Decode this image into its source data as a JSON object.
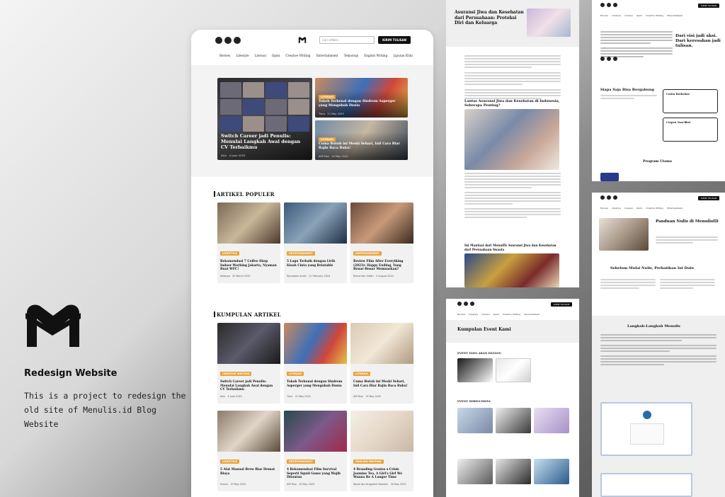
{
  "project": {
    "title": "Redesign Website",
    "description": "This is a project to redesign the old site of Menulis.id Blog Website",
    "logo_icon": "menulis-m-logo"
  },
  "colors": {
    "accent": "#e9a33b",
    "dark": "#111111"
  },
  "mockup": {
    "search_placeholder": "Cari artikel...",
    "cta_button": "KIRIM TULISAN",
    "nav": [
      "Review",
      "Lifestyle",
      "Literasi",
      "Opini",
      "Creative Writing",
      "Entertainment",
      "Teknologi",
      "English Writing",
      "Liputan Klini"
    ],
    "hero": {
      "main": {
        "title": "Switch Career jadi Penulis: Menulai Langkah Awal dengan CV Terbaikmu",
        "author": "Akiv",
        "date": "4 June 2025"
      },
      "side": [
        {
          "badge": "LITERASI",
          "title": "Tokoh Terkenal dengan Sindrom Asperger yang Mengubah Dunia",
          "author": "Tiara",
          "date": "21 May 2025"
        },
        {
          "badge": "LITERASI",
          "title": "Cuma Butuh ini Meski Sehari, Inil Cara Biar Rajin Baca Buku!",
          "author": "Afif Risa",
          "date": "19 May 2025"
        }
      ]
    },
    "popular": {
      "title": "ARTIKEL POPULER",
      "items": [
        {
          "badge": "LIFESTYLE",
          "title": "Rekomendasi 7 Coffee Shop Indoor Working Jakarta, Nyaman Buat WFC!",
          "author": "Natasya",
          "date": "22 March 2025"
        },
        {
          "badge": "ENTERTAINMENT",
          "title": "5 Lagu Terbaik dengan Lirik Kisah Cinta yang Relatable",
          "author": "Ramadani Andin",
          "date": "21 February 2024"
        },
        {
          "badge": "ENTERTAINMENT",
          "title": "Review Film After Everything (2023): Happy Ending, Yang Benar-Benar Memuaskan?",
          "author": "Risma Nur Safitri",
          "date": "5 August 2024"
        }
      ]
    },
    "collection": {
      "title": "KUMPULAN ARTIKEL",
      "items": [
        {
          "badge": "CREATIVE WRITING",
          "title": "Switch Career jadi Penulis: Menulai Langkah Awal dengan CV Terbaikmu",
          "author": "Akiv",
          "date": "4 June 2025"
        },
        {
          "badge": "LITERASI",
          "title": "Tokoh Terkenal dengan Sindrom Asperger yang Mengubah Dunia",
          "author": "Tiara",
          "date": "21 May 2025"
        },
        {
          "badge": "LITERASI",
          "title": "Cuma Butuh ini Meski Sehari, Inil Cara Biar Rajin Baca Buku!",
          "author": "Afif Risa",
          "date": "19 May 2025"
        },
        {
          "badge": "LIFESTYLE",
          "title": "5 Alat Manual Brew Biar Hemat Biaya",
          "author": "Fairuzi",
          "date": "19 May 2025"
        },
        {
          "badge": "ENTERTAINMENT",
          "title": "4 Rekomendasi Film Survival Seperti Squid Game yang Wajib Ditonton",
          "author": "Afif Risa",
          "date": "19 May 2025"
        },
        {
          "badge": "ENGLISH WRITING",
          "title": "4 Branding Genius x Crisis Jasmine Tea, A Girl's Girl We Wanna Be A Longer Time",
          "author": "Nayla Ayu Anggraini Ramdini",
          "date": "16 May 2025"
        }
      ]
    }
  },
  "article_page": {
    "title": "Asuransi Jiwa dan Kesehatan dari Perusahaan: Proteksi Diri dan Keluarga",
    "section_1": "Lantas Asuransi Jiwa dan Kesehatan di Indonesia, Seberapa Penting?",
    "section_2": "Ini Manfaat dari MenulIS Asuransi Jiwa dan Kesehatan dari Perusahaan Swasta"
  },
  "about_page": {
    "quote": "Dari visi jadi aksi. Dari keresahan jadi tulisan.",
    "section": "Siapa Saja Bisa Bergabung",
    "box_1": "Cerita Berkelasi",
    "box_2": "Cerpen Non-fiksi",
    "program": "Program Utama"
  },
  "events_page": {
    "title": "Kumpulan Event Kami",
    "upcoming": "EVENT YANG AKAN DATANG",
    "past": "EVENT SEBELUMNYA"
  },
  "guide_page": {
    "title": "Panduan Nulis di MenulisID",
    "intro": "Sebelum Mulai Nulis, Perhatikan Ini Dulu",
    "steps_title": "Langkah-Langkah Menulis"
  }
}
